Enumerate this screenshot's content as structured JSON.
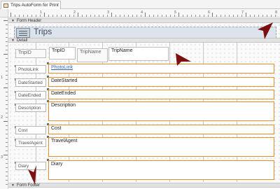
{
  "tab": {
    "title": "Trips AutoForm for Print",
    "icon": "form-icon"
  },
  "ruler": {
    "top_numbers": [
      "1",
      "2",
      "3",
      "4",
      "5",
      "6",
      "7",
      "8"
    ],
    "left_numbers": [
      "1",
      "2",
      "3"
    ]
  },
  "sections": {
    "form_header": "Form Header",
    "detail": "Detail",
    "form_footer": "Form Footer"
  },
  "header": {
    "title": "Trips"
  },
  "fields": {
    "trip_id": {
      "label": "TripID",
      "control": "TripID"
    },
    "trip_name": {
      "label": "TripName",
      "control": "TripName"
    },
    "photo_link": {
      "label": "PhotoLink",
      "control": "PhotoLink"
    },
    "date_started": {
      "label": "DateStarted",
      "control": "DateStarted"
    },
    "date_ended": {
      "label": "DateEnded",
      "control": "DateEnded"
    },
    "description": {
      "label": "Description",
      "control": "Description"
    },
    "cost": {
      "label": "Cost",
      "control": "Cost"
    },
    "travel_agent": {
      "label": "TravelAgent",
      "control": "TravelAgent"
    },
    "diary": {
      "label": "Diary",
      "control": "Diary"
    }
  },
  "colors": {
    "selection": "#e58e2c",
    "link": "#3a63b8",
    "pointer": "#7a1010"
  }
}
